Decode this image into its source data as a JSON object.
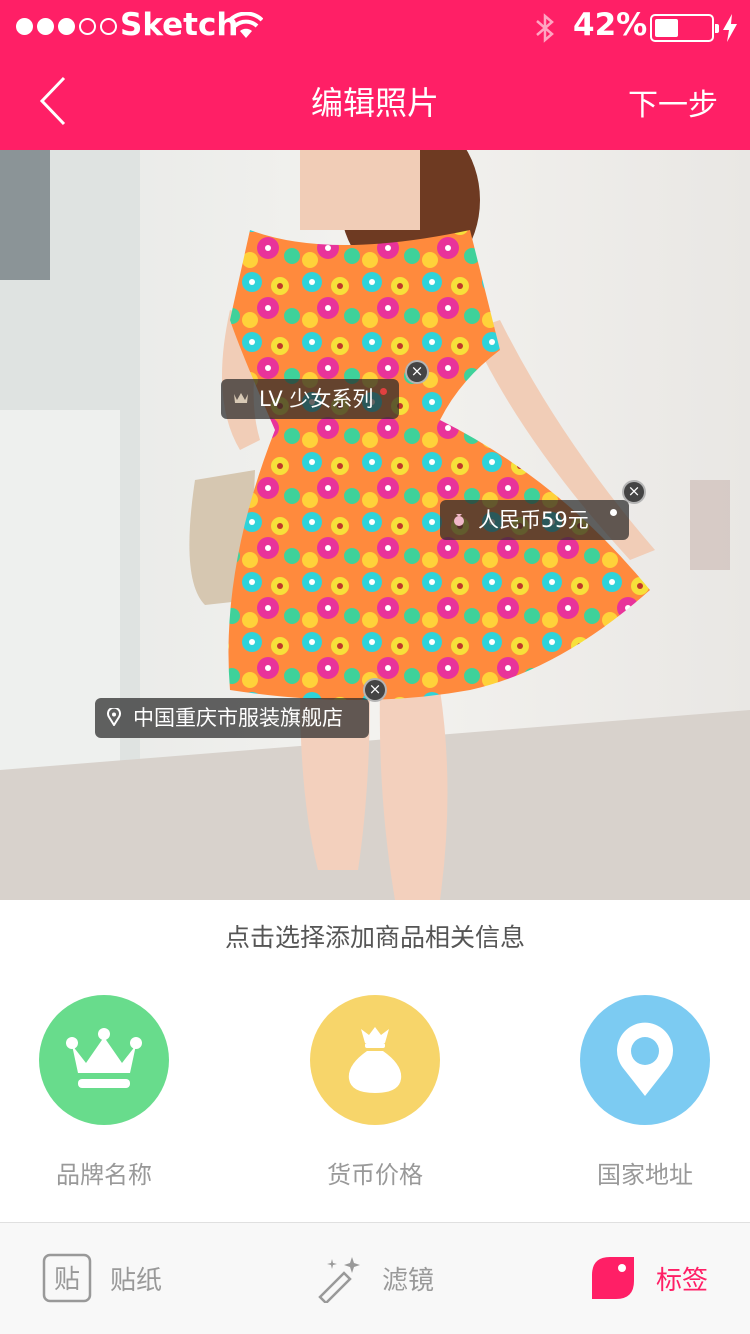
{
  "status_bar": {
    "carrier": "Sketch",
    "battery_percent": "42%",
    "battery_level": 0.42
  },
  "nav": {
    "title": "编辑照片",
    "next_label": "下一步"
  },
  "tags": [
    {
      "type": "brand",
      "text": "LV 少女系列"
    },
    {
      "type": "price",
      "text": "人民币59元"
    },
    {
      "type": "location",
      "text": "中国重庆市服装旗舰店"
    }
  ],
  "panel": {
    "hint": "点击选择添加商品相关信息",
    "options": [
      {
        "label": "品牌名称",
        "icon": "crown-icon",
        "color": "#68dc8c"
      },
      {
        "label": "货币价格",
        "icon": "money-bag-icon",
        "color": "#f7d56a"
      },
      {
        "label": "国家地址",
        "icon": "location-pin-icon",
        "color": "#7ccbf2"
      }
    ]
  },
  "bottom_tabs": [
    {
      "label": "贴纸",
      "icon": "sticker-icon"
    },
    {
      "label": "滤镜",
      "icon": "magic-wand-icon"
    },
    {
      "label": "标签",
      "icon": "tag-icon",
      "active": true
    }
  ],
  "colors": {
    "accent": "#ff1f66"
  }
}
